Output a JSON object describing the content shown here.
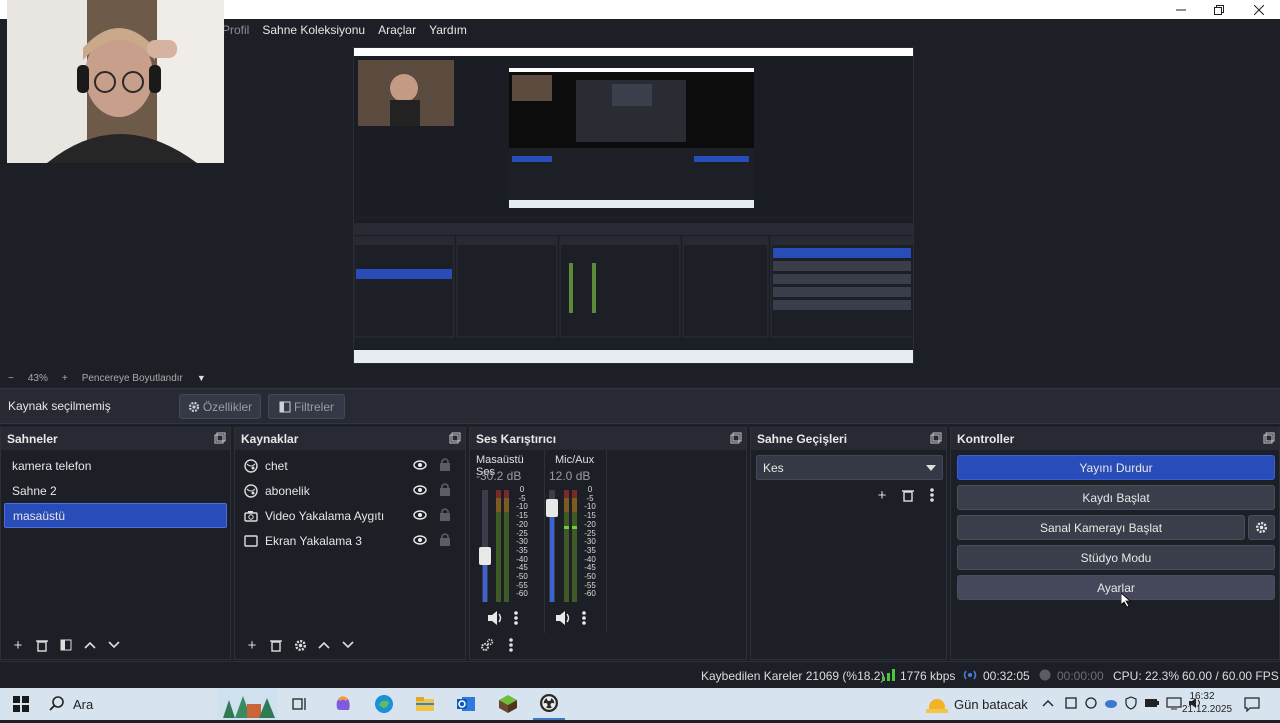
{
  "window": {
    "menu": [
      "Profil",
      "Sahne Koleksiyonu",
      "Araçlar",
      "Yardım"
    ]
  },
  "zoom": {
    "minus": "−",
    "level": "43%",
    "plus": "+",
    "fit_label": "Pencereye Boyutlandır"
  },
  "source_toolbar": {
    "status": "Kaynak seçilmemiş",
    "properties": "Özellikler",
    "filters": "Filtreler"
  },
  "scenes": {
    "title": "Sahneler",
    "items": [
      "kamera telefon",
      "Sahne 2",
      "masaüstü"
    ],
    "selected": 2
  },
  "sources": {
    "title": "Kaynaklar",
    "items": [
      {
        "label": "chet",
        "icon": "browser-icon"
      },
      {
        "label": "abonelik",
        "icon": "browser-icon"
      },
      {
        "label": "Video Yakalama Aygıtı",
        "icon": "camera-icon"
      },
      {
        "label": "Ekran Yakalama 3",
        "icon": "monitor-icon"
      }
    ]
  },
  "mixer": {
    "title": "Ses Karıştırıcı",
    "channels": [
      {
        "name": "Masaüstü Ses",
        "db": "-30.2 dB",
        "level": 0.39
      },
      {
        "name": "Mic/Aux",
        "db": "12.0 dB",
        "level": 0.9
      }
    ],
    "scale": [
      "0",
      "-5",
      "-10",
      "-15",
      "-20",
      "-25",
      "-30",
      "-35",
      "-40",
      "-45",
      "-50",
      "-55",
      "-60"
    ]
  },
  "transitions": {
    "title": "Sahne Geçişleri",
    "selected": "Kes"
  },
  "controls": {
    "title": "Kontroller",
    "stop_stream": "Yayını Durdur",
    "start_recording": "Kaydı Başlat",
    "start_virtual_cam": "Sanal Kamerayı Başlat",
    "studio_mode": "Stüdyo Modu",
    "settings": "Ayarlar"
  },
  "status": {
    "dropped_frames": "Kaybedilen Kareler 21069 (%18.2)",
    "bitrate": "1776 kbps",
    "stream_time": "00:32:05",
    "rec_time": "00:00:00",
    "cpu": "CPU: 22.3%",
    "fps": "60.00 / 60.00 FPS"
  },
  "taskbar": {
    "search": "Ara",
    "weather": "Gün batacak",
    "time": "16:32",
    "date": "21.12.2025"
  },
  "colors": {
    "accent": "#284cb8",
    "panel": "#1d1f26",
    "header": "#272a33"
  }
}
